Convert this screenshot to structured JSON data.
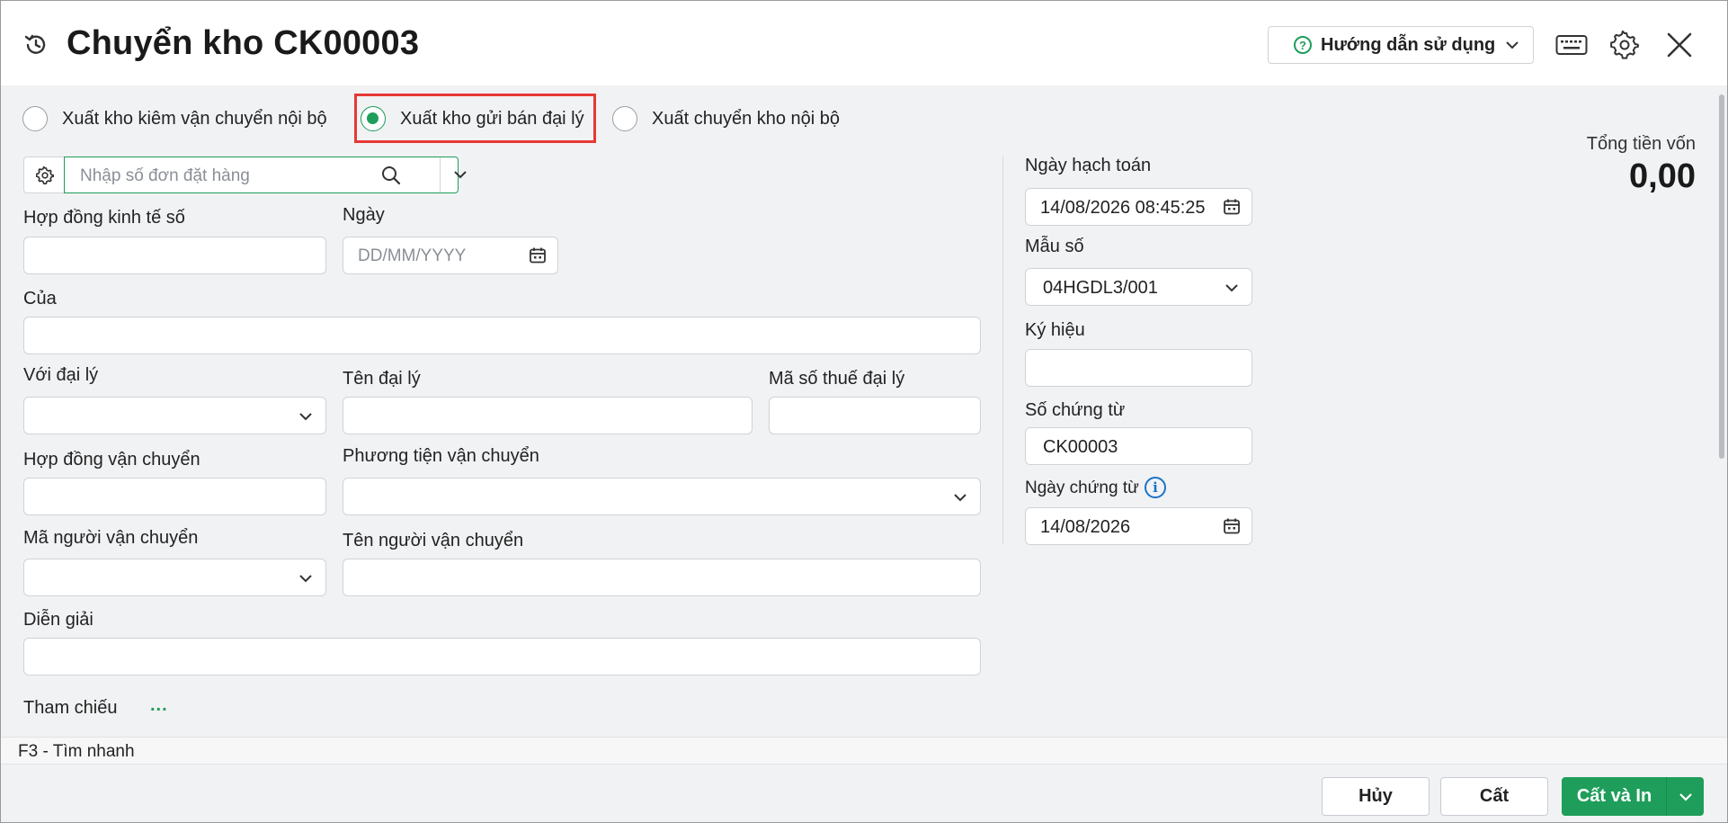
{
  "header": {
    "title": "Chuyển kho CK00003",
    "help_label": "Hướng dẫn sử dụng"
  },
  "radios": [
    {
      "label": "Xuất kho kiêm vận chuyển nội bộ",
      "selected": false
    },
    {
      "label": "Xuất kho gửi bán đại lý",
      "selected": true
    },
    {
      "label": "Xuất chuyển kho nội bộ",
      "selected": false
    }
  ],
  "order_search": {
    "placeholder": "Nhập số đơn đặt hàng"
  },
  "form": {
    "contract_label": "Hợp đồng kinh tế số",
    "contract_value": "",
    "date_label": "Ngày",
    "date_placeholder": "DD/MM/YYYY",
    "of_label": "Của",
    "of_value": "",
    "agent_label": "Với đại lý",
    "agent_name_label": "Tên đại lý",
    "agent_tax_label": "Mã số thuế đại lý",
    "transport_contract_label": "Hợp đồng vận chuyển",
    "vehicle_label": "Phương tiện vận chuyển",
    "carrier_code_label": "Mã người vận chuyển",
    "carrier_name_label": "Tên người vận chuyển",
    "description_label": "Diễn giải",
    "reference_label": "Tham chiếu",
    "reference_more": "..."
  },
  "right_panel": {
    "posting_date_label": "Ngày hạch toán",
    "posting_date_value": "14/08/2026 08:45:25",
    "template_label": "Mẫu số",
    "template_value": "04HGDL3/001",
    "symbol_label": "Ký hiệu",
    "symbol_value": "",
    "voucher_no_label": "Số chứng từ",
    "voucher_no_value": "CK00003",
    "voucher_date_label": "Ngày chứng từ",
    "voucher_date_value": "14/08/2026"
  },
  "total": {
    "label": "Tổng tiền vốn",
    "value": "0,00"
  },
  "status": {
    "shortcut": "F3 - Tìm nhanh"
  },
  "footer": {
    "cancel_label": "Hủy",
    "save_label": "Cất",
    "save_print_label": "Cất và In"
  },
  "colors": {
    "accent": "#1e9e5a",
    "highlight": "#e53935",
    "info": "#1a73c8"
  }
}
